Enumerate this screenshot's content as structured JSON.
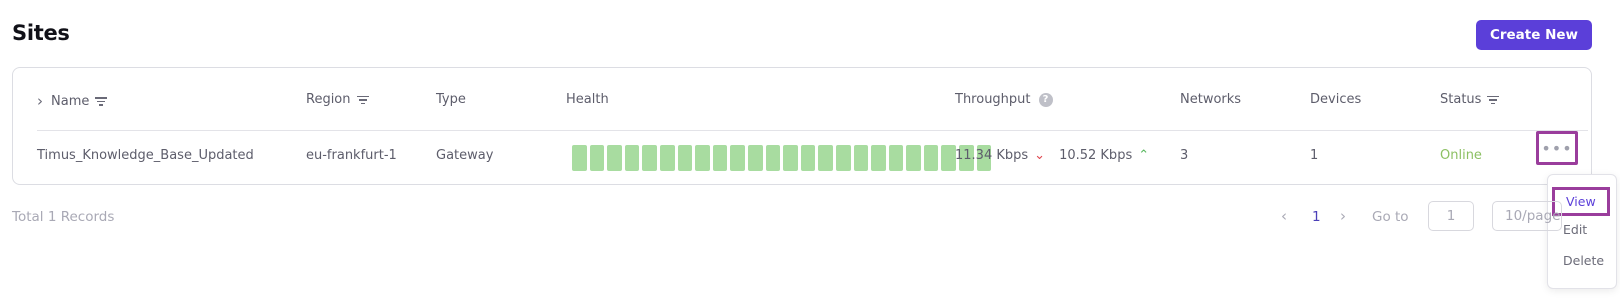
{
  "page": {
    "title": "Sites",
    "create_label": "Create New"
  },
  "table": {
    "columns": {
      "name": "Name",
      "region": "Region",
      "type": "Type",
      "health": "Health",
      "throughput": "Throughput",
      "networks": "Networks",
      "devices": "Devices",
      "status": "Status"
    },
    "rows": [
      {
        "name": "Timus_Knowledge_Base_Updated",
        "region": "eu-frankfurt-1",
        "type": "Gateway",
        "health_segments": 24,
        "health_color": "#a8dca0",
        "throughput_down": "11.34 Kbps",
        "throughput_up": "10.52 Kbps",
        "networks": "3",
        "devices": "1",
        "status": "Online",
        "status_color": "#8cc063"
      }
    ]
  },
  "row_menu": {
    "items": [
      "View",
      "Edit",
      "Delete"
    ]
  },
  "footer": {
    "total": "Total 1  Records",
    "current_page": "1",
    "goto_label": "Go to",
    "goto_value": "1",
    "page_size": "10/page"
  },
  "colors": {
    "accent": "#5b3fd9",
    "highlight": "#9a3d9c",
    "down": "#e0464f",
    "up": "#5ab860"
  }
}
